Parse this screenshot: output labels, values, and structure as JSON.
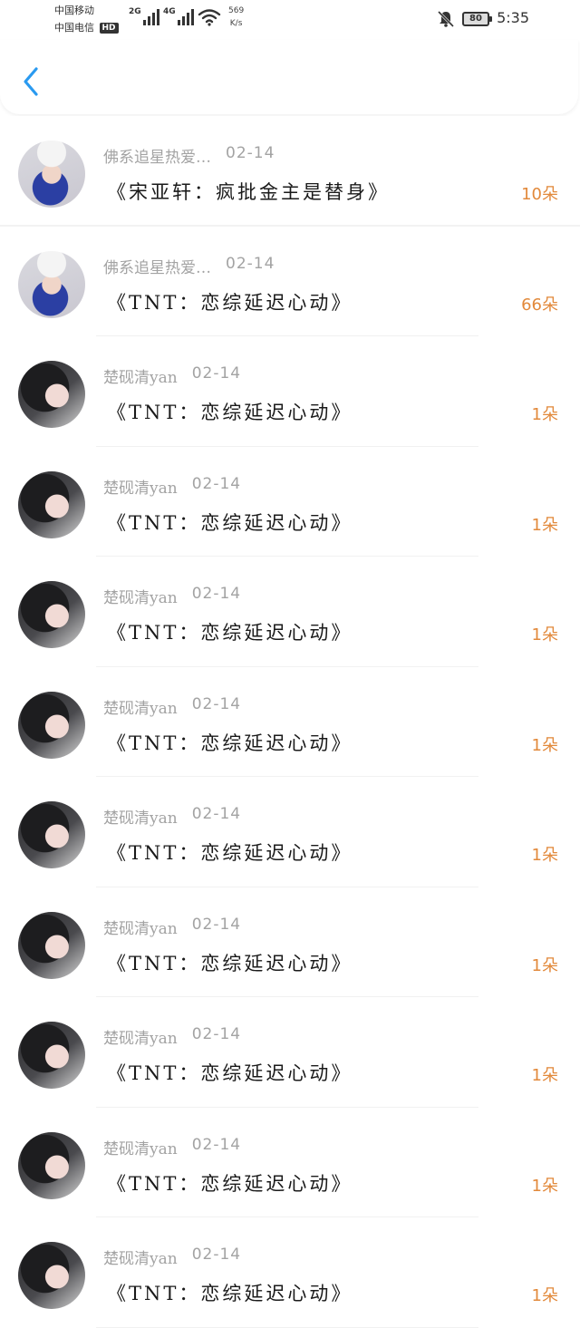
{
  "status_bar": {
    "carrier_1": "中国移动",
    "carrier_2": "中国电信",
    "hd": "HD",
    "net_1": "2G",
    "net_2": "4G",
    "speed_value": "569",
    "speed_unit": "K/s",
    "battery": "80",
    "time": "5:35"
  },
  "header": {
    "back_icon": "chevron-left-icon",
    "accent_color": "#2a9af0"
  },
  "list": {
    "items": [
      {
        "user": "佛系追星热爱…",
        "date": "02-14",
        "title": "《宋亚轩：疯批金主是替身》",
        "count": "10朵",
        "avatar": "white"
      },
      {
        "user": "佛系追星热爱…",
        "date": "02-14",
        "title": "《TNT：恋综延迟心动》",
        "count": "66朵",
        "avatar": "white"
      },
      {
        "user": "楚砚清yan",
        "date": "02-14",
        "title": "《TNT：恋综延迟心动》",
        "count": "1朵",
        "avatar": "dark"
      },
      {
        "user": "楚砚清yan",
        "date": "02-14",
        "title": "《TNT：恋综延迟心动》",
        "count": "1朵",
        "avatar": "dark"
      },
      {
        "user": "楚砚清yan",
        "date": "02-14",
        "title": "《TNT：恋综延迟心动》",
        "count": "1朵",
        "avatar": "dark"
      },
      {
        "user": "楚砚清yan",
        "date": "02-14",
        "title": "《TNT：恋综延迟心动》",
        "count": "1朵",
        "avatar": "dark"
      },
      {
        "user": "楚砚清yan",
        "date": "02-14",
        "title": "《TNT：恋综延迟心动》",
        "count": "1朵",
        "avatar": "dark"
      },
      {
        "user": "楚砚清yan",
        "date": "02-14",
        "title": "《TNT：恋综延迟心动》",
        "count": "1朵",
        "avatar": "dark"
      },
      {
        "user": "楚砚清yan",
        "date": "02-14",
        "title": "《TNT：恋综延迟心动》",
        "count": "1朵",
        "avatar": "dark"
      },
      {
        "user": "楚砚清yan",
        "date": "02-14",
        "title": "《TNT：恋综延迟心动》",
        "count": "1朵",
        "avatar": "dark"
      },
      {
        "user": "楚砚清yan",
        "date": "02-14",
        "title": "《TNT：恋综延迟心动》",
        "count": "1朵",
        "avatar": "dark"
      }
    ]
  },
  "colors": {
    "count": "#e2893b",
    "meta": "#a3a3a3"
  }
}
